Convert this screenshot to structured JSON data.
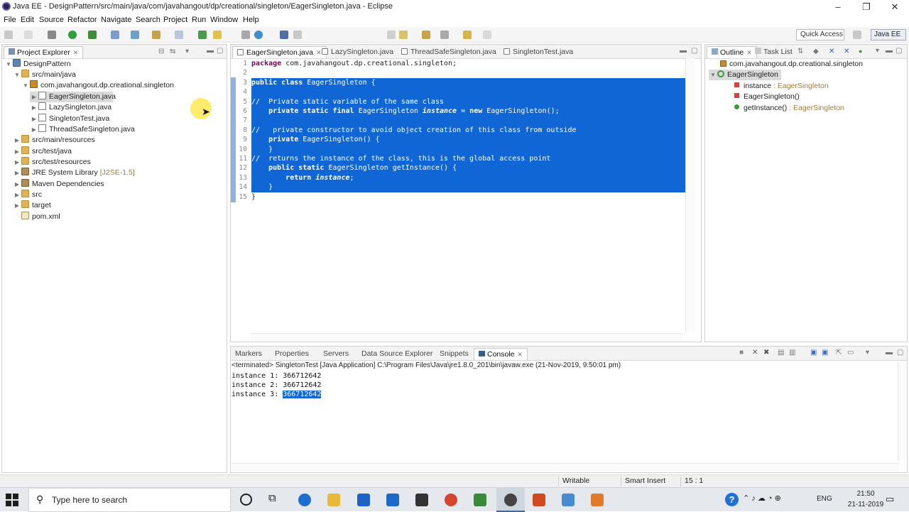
{
  "window": {
    "title": "Java EE - DesignPattern/src/main/java/com/javahangout/dp/creational/singleton/EagerSingleton.java - Eclipse"
  },
  "menu": [
    "File",
    "Edit",
    "Source",
    "Refactor",
    "Navigate",
    "Search",
    "Project",
    "Run",
    "Window",
    "Help"
  ],
  "toolbar": {
    "quick_access": "Quick Access",
    "perspective": "Java EE"
  },
  "explorer": {
    "title": "Project Explorer",
    "project": "DesignPattern",
    "src_main_java": "src/main/java",
    "package": "com.javahangout.dp.creational.singleton",
    "files": [
      "EagerSingleton.java",
      "LazySingleton.java",
      "SingletonTest.java",
      "ThreadSafeSingleton.java"
    ],
    "src_main_resources": "src/main/resources",
    "src_test_java": "src/test/java",
    "src_test_resources": "src/test/resources",
    "jre": "JRE System Library",
    "jre_version": "[J2SE-1.5]",
    "maven": "Maven Dependencies",
    "src": "src",
    "target": "target",
    "pom": "pom.xml"
  },
  "editor": {
    "tabs": [
      "EagerSingleton.java",
      "LazySingleton.java",
      "ThreadSafeSingleton.java",
      "SingletonTest.java"
    ],
    "line_numbers": [
      "1",
      "2",
      "3",
      "4",
      "5",
      "6",
      "7",
      "8",
      "9",
      "10",
      "11",
      "12",
      "13",
      "14",
      "15"
    ],
    "lines": [
      "package com.javahangout.dp.creational.singleton;",
      "",
      "public class EagerSingleton {",
      "",
      "//  Private static variable of the same class",
      "    private static final EagerSingleton instance = new EagerSingleton();",
      "",
      "//   private constructor to avoid object creation of this class from outside",
      "    private EagerSingleton() {",
      "    }",
      "//  returns the instance of the class, this is the global access point",
      "    public static EagerSingleton getInstance() {",
      "        return instance;",
      "    }",
      "}"
    ]
  },
  "bottom_panel": {
    "tabs": [
      "Markers",
      "Properties",
      "Servers",
      "Data Source Explorer",
      "Snippets",
      "Console"
    ],
    "console_header": "<terminated> SingletonTest [Java Application] C:\\Program Files\\Java\\jre1.8.0_201\\bin\\javaw.exe (21-Nov-2019, 9:50:01 pm)",
    "output": [
      {
        "label": "instance 1: ",
        "value": "366712642"
      },
      {
        "label": "instance 2: ",
        "value": "366712642"
      },
      {
        "label": "instance 3: ",
        "value": "366712642"
      }
    ]
  },
  "outline": {
    "tabs": [
      "Outline",
      "Task List"
    ],
    "package": "com.javahangout.dp.creational.singleton",
    "class": "EagerSingleton",
    "members": [
      {
        "name": "instance",
        "type": " : EagerSingleton"
      },
      {
        "name": "EagerSingleton()",
        "type": ""
      },
      {
        "name": "getInstance()",
        "type": " : EagerSingleton"
      }
    ]
  },
  "status": {
    "mode": "Writable",
    "insert": "Smart Insert",
    "position": "15 : 1"
  },
  "taskbar": {
    "search_placeholder": "Type here to search",
    "language": "ENG",
    "time": "21:50",
    "date": "21-11-2019"
  }
}
